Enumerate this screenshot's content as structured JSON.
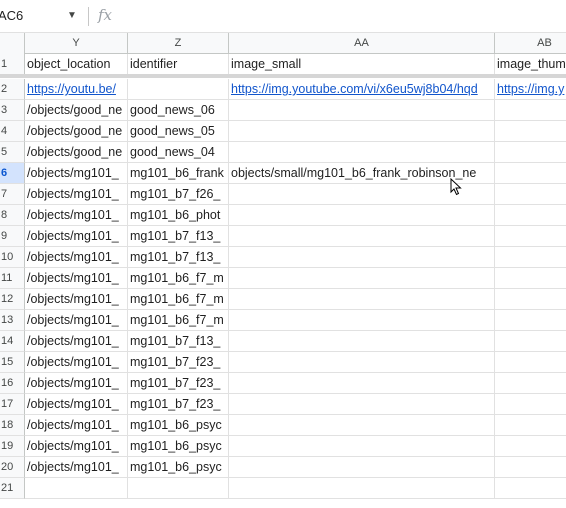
{
  "formula_bar": {
    "name_box": "AC6",
    "fx_label": "fx",
    "formula": ""
  },
  "columns": [
    {
      "letter": "Y"
    },
    {
      "letter": "Z"
    },
    {
      "letter": "AA"
    },
    {
      "letter": "AB"
    }
  ],
  "rows": [
    {
      "num": "1",
      "cells": [
        "object_location",
        "identifier",
        "image_small",
        "image_thumb"
      ]
    },
    {
      "num": "2",
      "cells": [
        "https://youtu.be/",
        "",
        "https://img.youtube.com/vi/x6eu5wj8b04/hqd",
        "https://img.y"
      ]
    },
    {
      "num": "3",
      "cells": [
        "/objects/good_ne",
        "good_news_06",
        "",
        ""
      ]
    },
    {
      "num": "4",
      "cells": [
        "/objects/good_ne",
        "good_news_05",
        "",
        ""
      ]
    },
    {
      "num": "5",
      "cells": [
        "/objects/good_ne",
        "good_news_04",
        "",
        ""
      ]
    },
    {
      "num": "6",
      "cells": [
        "/objects/mg101_",
        "mg101_b6_frank",
        "objects/small/mg101_b6_frank_robinson_ne",
        ""
      ]
    },
    {
      "num": "7",
      "cells": [
        "/objects/mg101_",
        "mg101_b7_f26_",
        "",
        ""
      ]
    },
    {
      "num": "8",
      "cells": [
        "/objects/mg101_",
        "mg101_b6_phot",
        "",
        ""
      ]
    },
    {
      "num": "9",
      "cells": [
        "/objects/mg101_",
        "mg101_b7_f13_",
        "",
        ""
      ]
    },
    {
      "num": "10",
      "cells": [
        "/objects/mg101_",
        "mg101_b7_f13_",
        "",
        ""
      ]
    },
    {
      "num": "11",
      "cells": [
        "/objects/mg101_",
        "mg101_b6_f7_m",
        "",
        ""
      ]
    },
    {
      "num": "12",
      "cells": [
        "/objects/mg101_",
        "mg101_b6_f7_m",
        "",
        ""
      ]
    },
    {
      "num": "13",
      "cells": [
        "/objects/mg101_",
        "mg101_b6_f7_m",
        "",
        ""
      ]
    },
    {
      "num": "14",
      "cells": [
        "/objects/mg101_",
        "mg101_b7_f13_",
        "",
        ""
      ]
    },
    {
      "num": "15",
      "cells": [
        "/objects/mg101_",
        "mg101_b7_f23_",
        "",
        ""
      ]
    },
    {
      "num": "16",
      "cells": [
        "/objects/mg101_",
        "mg101_b7_f23_",
        "",
        ""
      ]
    },
    {
      "num": "17",
      "cells": [
        "/objects/mg101_",
        "mg101_b7_f23_",
        "",
        ""
      ]
    },
    {
      "num": "18",
      "cells": [
        "/objects/mg101_",
        "mg101_b6_psyc",
        "",
        ""
      ]
    },
    {
      "num": "19",
      "cells": [
        "/objects/mg101_",
        "mg101_b6_psyc",
        "",
        ""
      ]
    },
    {
      "num": "20",
      "cells": [
        "/objects/mg101_",
        "mg101_b6_psyc",
        "",
        ""
      ]
    },
    {
      "num": "21",
      "cells": [
        "",
        "",
        "",
        ""
      ]
    }
  ],
  "active_row": "6",
  "colors": {
    "link": "#1155cc",
    "header_bg": "#f8f9fa",
    "active_row_bg": "#d3e3fd",
    "active_row_text": "#0b57d0"
  }
}
